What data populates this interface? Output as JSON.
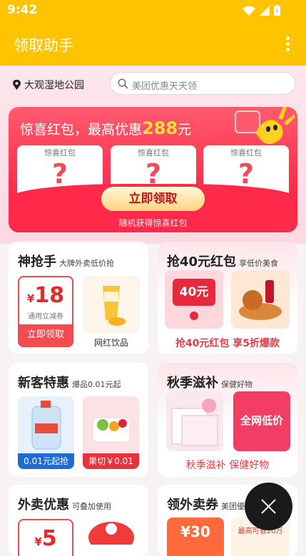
{
  "status": {
    "time": "9:42"
  },
  "appbar": {
    "title": "领取助手",
    "menu_icon": "more-vertical-icon"
  },
  "location": {
    "name": "大观湿地公园",
    "icon": "location-pin-icon"
  },
  "search": {
    "placeholder": "美团优惠天天领",
    "icon": "search-icon"
  },
  "surprise": {
    "headline": "惊喜红包，最高优惠",
    "amount": "288",
    "unit": "元",
    "pockets": [
      {
        "label": "惊喜红包",
        "mark": "?"
      },
      {
        "label": "惊喜红包",
        "mark": "?"
      },
      {
        "label": "惊喜红包",
        "mark": "?"
      }
    ],
    "claim_label": "立即领取",
    "subtext": "随机获得惊喜红包"
  },
  "cards": {
    "flash": {
      "title": "神抢手",
      "subtitle": "大牌外卖低价抢",
      "coupon_currency": "¥",
      "coupon_amount": "18",
      "coupon_note": "通用立减券",
      "coupon_button": "立即领取",
      "product_label": "网红饮品"
    },
    "redpack40": {
      "title": "抢40元红包",
      "subtitle": "享低价美食",
      "badge": "40元",
      "caption": "抢40元红包 享5折爆款"
    },
    "newcomer": {
      "title": "新客特惠",
      "subtitle": "爆品0.01元起",
      "item1_label": "0.01元起抢",
      "item2_label": "果切￥0.01"
    },
    "autumn": {
      "title": "秋季滋补",
      "subtitle": "保健好物",
      "promo": "全网低价",
      "caption": "秋季滋补 保健好物"
    },
    "takeout": {
      "title": "外卖优惠",
      "subtitle": "可叠加使用",
      "coupon_currency": "¥",
      "coupon_amount": "5"
    },
    "extra": {
      "title": "领外卖券",
      "subtitle": "美团優",
      "tile1": "¥30",
      "tile2": "最高可省20万"
    }
  },
  "fab": {
    "icon": "close-icon"
  }
}
